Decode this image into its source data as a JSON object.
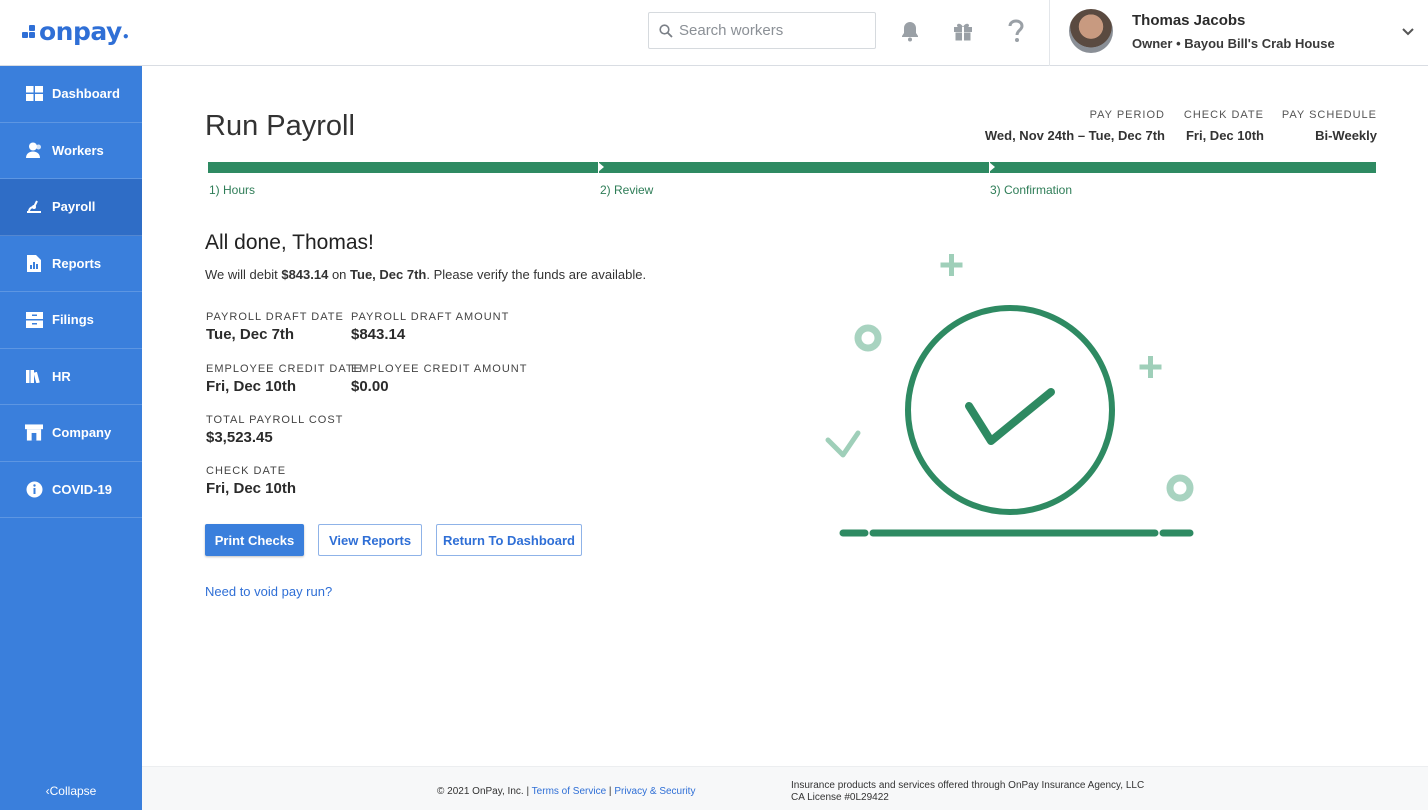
{
  "brand": {
    "name": "onpay",
    "color": "#2f6fd6"
  },
  "search": {
    "placeholder": "Search workers"
  },
  "header_icons": [
    "bell-icon",
    "gift-icon",
    "help-icon"
  ],
  "user": {
    "name": "Thomas Jacobs",
    "role": "Owner • Bayou Bill's Crab House"
  },
  "sidebar": {
    "items": [
      {
        "label": "Dashboard",
        "icon": "dashboard-icon"
      },
      {
        "label": "Workers",
        "icon": "workers-icon"
      },
      {
        "label": "Payroll",
        "icon": "payroll-icon",
        "active": true
      },
      {
        "label": "Reports",
        "icon": "reports-icon"
      },
      {
        "label": "Filings",
        "icon": "filings-icon"
      },
      {
        "label": "HR",
        "icon": "hr-icon"
      },
      {
        "label": "Company",
        "icon": "company-icon"
      },
      {
        "label": "COVID-19",
        "icon": "info-icon"
      }
    ],
    "collapse_label": "Collapse"
  },
  "page": {
    "title": "Run Payroll",
    "meta": {
      "pay_period_label": "PAY PERIOD",
      "pay_period": "Wed, Nov 24th – Tue, Dec 7th",
      "check_date_label": "CHECK DATE",
      "check_date": "Fri, Dec 10th",
      "pay_schedule_label": "PAY SCHEDULE",
      "pay_schedule": "Bi-Weekly"
    },
    "steps": [
      "1) Hours",
      "2) Review",
      "3) Confirmation"
    ],
    "done_title": "All done, Thomas!",
    "done_msg": {
      "pre": "We will debit ",
      "amount": "$843.14",
      "mid": " on ",
      "date": "Tue, Dec 7th",
      "post": ". Please verify the funds are available."
    },
    "fields": {
      "draft_date_label": "PAYROLL DRAFT DATE",
      "draft_date": "Tue, Dec 7th",
      "draft_amount_label": "PAYROLL DRAFT AMOUNT",
      "draft_amount": "$843.14",
      "credit_date_label": "EMPLOYEE CREDIT DATE",
      "credit_date": "Fri, Dec 10th",
      "credit_amount_label": "EMPLOYEE CREDIT AMOUNT",
      "credit_amount": "$0.00",
      "total_cost_label": "TOTAL PAYROLL COST",
      "total_cost": "$3,523.45",
      "check_date_label": "CHECK DATE",
      "check_date": "Fri, Dec 10th"
    },
    "buttons": {
      "print": "Print Checks",
      "reports": "View Reports",
      "dashboard": "Return To Dashboard"
    },
    "void_link": "Need to void pay run?"
  },
  "footer": {
    "copyright": "© 2021 OnPay, Inc. |",
    "terms": "Terms of Service",
    "sep": "|",
    "privacy": "Privacy & Security",
    "insurance_line1": "Insurance products and services offered through OnPay Insurance Agency, LLC",
    "insurance_line2": "CA License #0L29422"
  },
  "colors": {
    "accent": "#3a7fdc",
    "success": "#2e8a62",
    "success_light": "#9fcfb9"
  }
}
